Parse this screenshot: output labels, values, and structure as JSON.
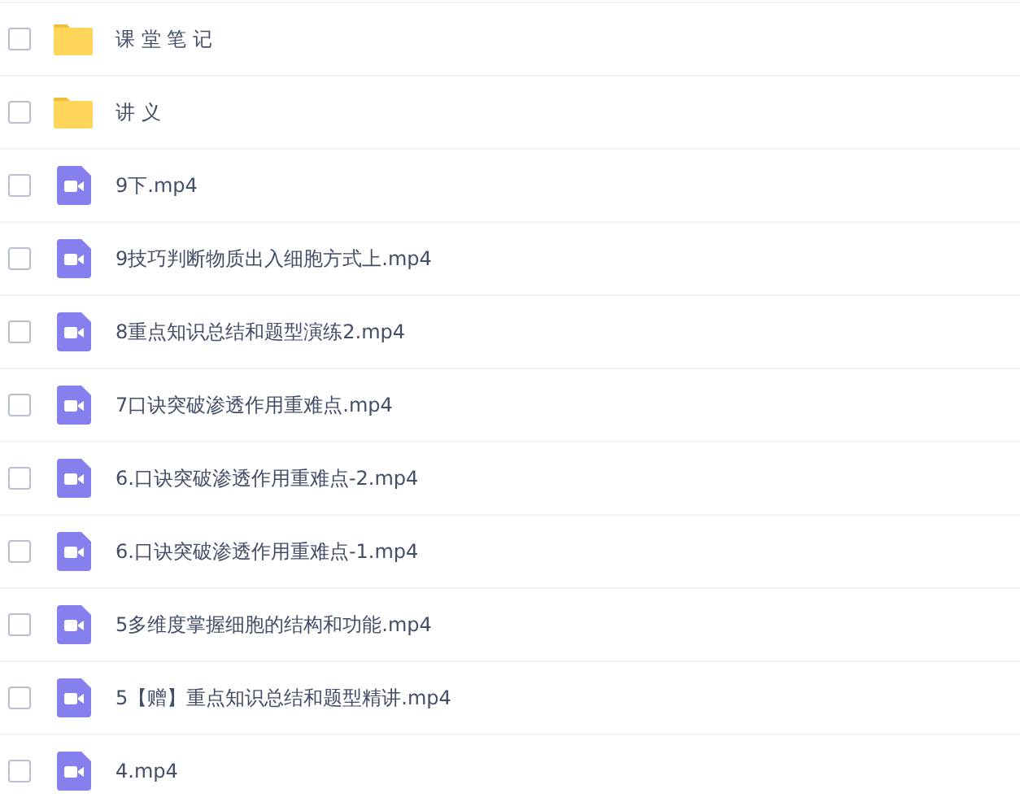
{
  "files": [
    {
      "kind": "folder",
      "name": "课 堂 笔 记",
      "checked": false
    },
    {
      "kind": "folder",
      "name": "讲 义",
      "checked": false
    },
    {
      "kind": "video",
      "name": "9下.mp4",
      "checked": false
    },
    {
      "kind": "video",
      "name": "9技巧判断物质出入细胞方式上.mp4",
      "checked": false
    },
    {
      "kind": "video",
      "name": "8重点知识总结和题型演练2.mp4",
      "checked": false
    },
    {
      "kind": "video",
      "name": "7口诀突破渗透作用重难点.mp4",
      "checked": false
    },
    {
      "kind": "video",
      "name": "6.口诀突破渗透作用重难点-2.mp4",
      "checked": false
    },
    {
      "kind": "video",
      "name": "6.口诀突破渗透作用重难点-1.mp4",
      "checked": false
    },
    {
      "kind": "video",
      "name": "5多维度掌握细胞的结构和功能.mp4",
      "checked": false
    },
    {
      "kind": "video",
      "name": "5【赠】重点知识总结和题型精讲.mp4",
      "checked": false
    },
    {
      "kind": "video",
      "name": "4.mp4",
      "checked": false
    }
  ]
}
